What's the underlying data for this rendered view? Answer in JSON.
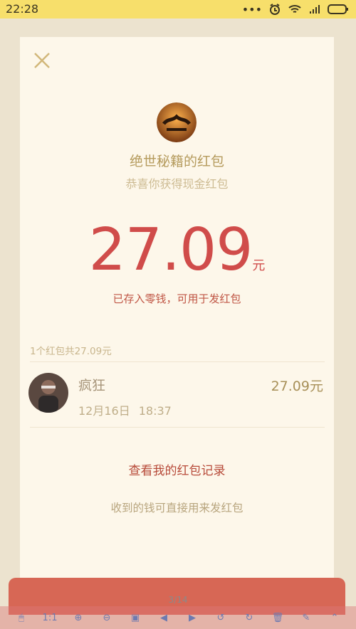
{
  "status": {
    "time": "22:28"
  },
  "card": {
    "title": "绝世秘籍的红包",
    "subtitle": "恭喜你获得现金红包",
    "amount": "27.09",
    "amount_unit": "元",
    "note": "已存入零钱，可用于发红包",
    "summary": "1个红包共27.09元",
    "records_link": "查看我的红包记录",
    "hint": "收到的钱可直接用来发红包"
  },
  "record": {
    "name": "疯狂",
    "date": "12月16日",
    "time": "18:37",
    "amount": "27.09元"
  },
  "viewer": {
    "page": "3/14",
    "ratio_label": "1:1"
  }
}
